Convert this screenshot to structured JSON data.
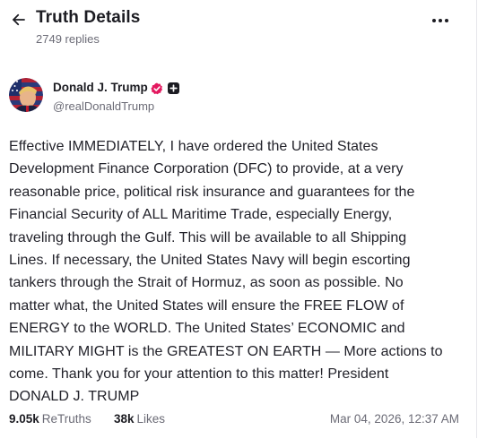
{
  "header": {
    "title": "Truth Details",
    "replies": "2749 replies",
    "back_icon": "arrow-left-icon",
    "more_icon": "more-horizontal-icon"
  },
  "author": {
    "name": "Donald J. Trump",
    "handle": "@realDonaldTrump",
    "verified_color": "#e3195f",
    "badges": [
      "verified-badge-icon",
      "plus-badge-icon"
    ]
  },
  "post": {
    "lines": [
      "Effective IMMEDIATELY, I have ordered the United States",
      "Development Finance Corporation (DFC) to provide, at a very",
      "reasonable price, political risk insurance and guarantees for the",
      "Financial Security of ALL Maritime Trade, especially Energy,",
      "traveling through the Gulf. This will be available to all Shipping",
      "Lines. If necessary, the United States Navy will begin escorting",
      "tankers through the Strait of Hormuz, as soon as possible. No",
      "matter what, the United States will ensure the FREE FLOW of",
      "ENERGY to the WORLD. The United States’ ECONOMIC and",
      "MILITARY MIGHT is the GREATEST ON EARTH — More actions to",
      "come. Thank you for your attention to this matter! President",
      "DONALD J. TRUMP"
    ]
  },
  "stats": {
    "retruths_count": "9.05k",
    "retruths_label": "ReTruths",
    "likes_count": "38k",
    "likes_label": "Likes",
    "timestamp": "Mar 04, 2026, 12:37 AM"
  }
}
